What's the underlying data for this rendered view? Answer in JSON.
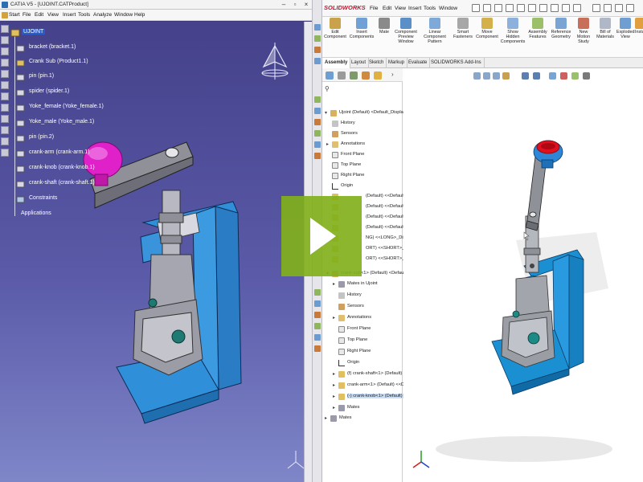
{
  "catia": {
    "title": "CATIA V5 - [UJOINT.CATProduct]",
    "menu": [
      "Start",
      "File",
      "Edit",
      "View",
      "Insert",
      "Tools",
      "Analyze",
      "Window",
      "Help"
    ],
    "tree": {
      "root": "UJOINT",
      "items": [
        "bracket (bracket.1)",
        "Crank Sub (Product1.1)",
        "pin (pin.1)",
        "spider (spider.1)",
        "Yoke_female (Yoke_female.1)",
        "Yoke_male (Yoke_male.1)",
        "pin (pin.2)",
        "crank-arm (crank-arm.1)",
        "crank-knob (crank-knob.1)",
        "crank-shaft (crank-shaft.1)",
        "Constraints",
        "Applications"
      ]
    },
    "colors": {
      "part_body": "#2f8fd8",
      "knob": "#e020c8",
      "metal": "#a9a9a9",
      "background": "#4a468f"
    }
  },
  "player": {
    "play_button_color": "#81b01b",
    "play_icon": "play-triangle-icon"
  },
  "solidworks": {
    "logo": "SOLIDWORKS",
    "menu": [
      "File",
      "Edit",
      "View",
      "Insert",
      "Tools",
      "Window"
    ],
    "ribbon": [
      "Edit Component",
      "Insert Components",
      "Mate",
      "Component Preview Window",
      "Linear Component Pattern",
      "Smart Fasteners",
      "Move Component",
      "Show Hidden Components",
      "Assembly Features",
      "Reference Geometry",
      "New Motion Study",
      "Bill of Materials",
      "Exploded View",
      "Instant3D"
    ],
    "tabs": [
      "Assembly",
      "Layout",
      "Sketch",
      "Markup",
      "Evaluate",
      "SOLIDWORKS Add-Ins"
    ],
    "active_tab": "Assembly",
    "tree": {
      "root": "Ujoint (Default) <Default_Display State-1",
      "top_items": [
        "History",
        "Sensors",
        "Annotations",
        "Front Plane",
        "Top Plane",
        "Right Plane",
        "Origin"
      ],
      "partial_items": [
        "(Default) <<Default",
        "(Default) <<Default>",
        "(Default) <<Default>_",
        "(Default) <<Default>_",
        "NG) <<LONG>_Displ",
        "ORT) <<SHORT>_Disp",
        "ORT) <<SHORT>_Disp"
      ],
      "sub_assembly": "crank-sub<1> (Default) <Default_",
      "sub_items": [
        "Mates in Ujoint",
        "History",
        "Sensors",
        "Annotations",
        "Front Plane",
        "Top Plane",
        "Right Plane",
        "Origin"
      ],
      "sub_parts": [
        "(f) crank-shaft<1> (Default) <<",
        "crank-arm<1> (Default) <<Default",
        "(-) crank-knob<1> (Default) <<"
      ],
      "sub_mates": "Mates",
      "mates": "Mates"
    },
    "colors": {
      "part_body": "#1a8fd2",
      "knob_rim": "#2e86d6",
      "knob_inner": "#e01020",
      "metal": "#9fa3a8"
    }
  }
}
